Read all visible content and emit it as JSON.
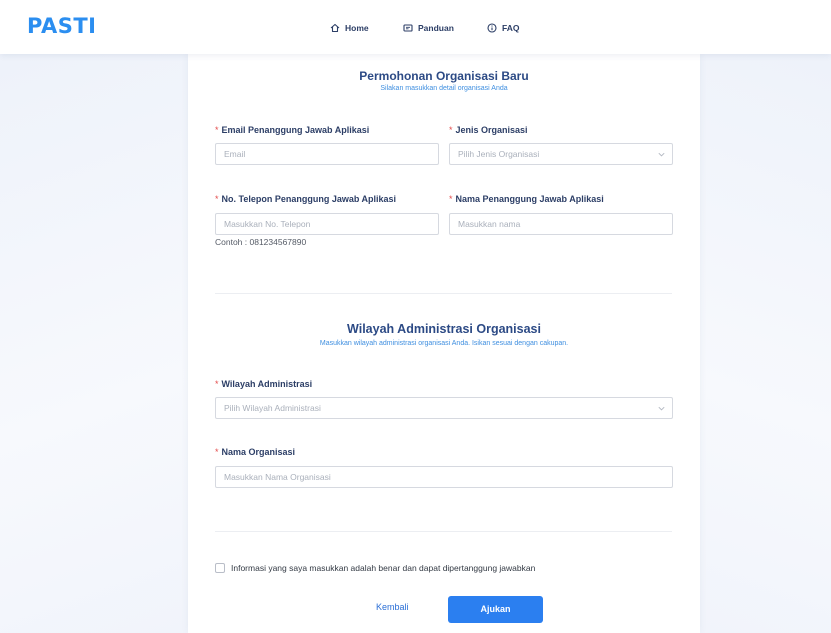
{
  "brand": {
    "logo_text": "PASTI",
    "color": "#2b8ef0"
  },
  "nav": {
    "items": [
      {
        "label": "Home",
        "icon": "home-icon"
      },
      {
        "label": "Panduan",
        "icon": "book-icon"
      },
      {
        "label": "FAQ",
        "icon": "info-circle-icon"
      }
    ]
  },
  "form": {
    "org_section": {
      "title": "Permohonan Organisasi Baru",
      "subtitle": "Silakan masukkan detail organisasi Anda"
    },
    "fields": {
      "email": {
        "label": "Email Penanggung Jawab Aplikasi",
        "placeholder": "Email",
        "required": true
      },
      "jenis": {
        "label": "Jenis Organisasi",
        "placeholder": "Pilih Jenis Organisasi",
        "required": true
      },
      "telepon": {
        "label": "No. Telepon Penanggung Jawab Aplikasi",
        "placeholder": "Masukkan No. Telepon",
        "hint": "Contoh : 081234567890",
        "required": true
      },
      "nama_pj": {
        "label": "Nama Penanggung Jawab Aplikasi",
        "placeholder": "Masukkan nama",
        "required": true
      },
      "wilayah": {
        "label": "Wilayah Administrasi",
        "placeholder": "Pilih Wilayah Administrasi",
        "required": true
      },
      "nama_org": {
        "label": "Nama Organisasi",
        "placeholder": "Masukkan Nama Organisasi",
        "required": true
      }
    },
    "region_section": {
      "title": "Wilayah Administrasi Organisasi",
      "subtitle": "Masukkan wilayah administrasi organisasi Anda. Isikan sesuai dengan cakupan."
    },
    "required_marker": "*",
    "agreement": {
      "label": "Informasi yang saya masukkan adalah benar dan dapat dipertanggung jawabkan",
      "checked": false
    },
    "actions": {
      "back_label": "Kembali",
      "submit_label": "Ajukan"
    }
  },
  "colors": {
    "accent": "#2b7ff0",
    "title": "#2c4a85",
    "required": "#e34b4b"
  }
}
